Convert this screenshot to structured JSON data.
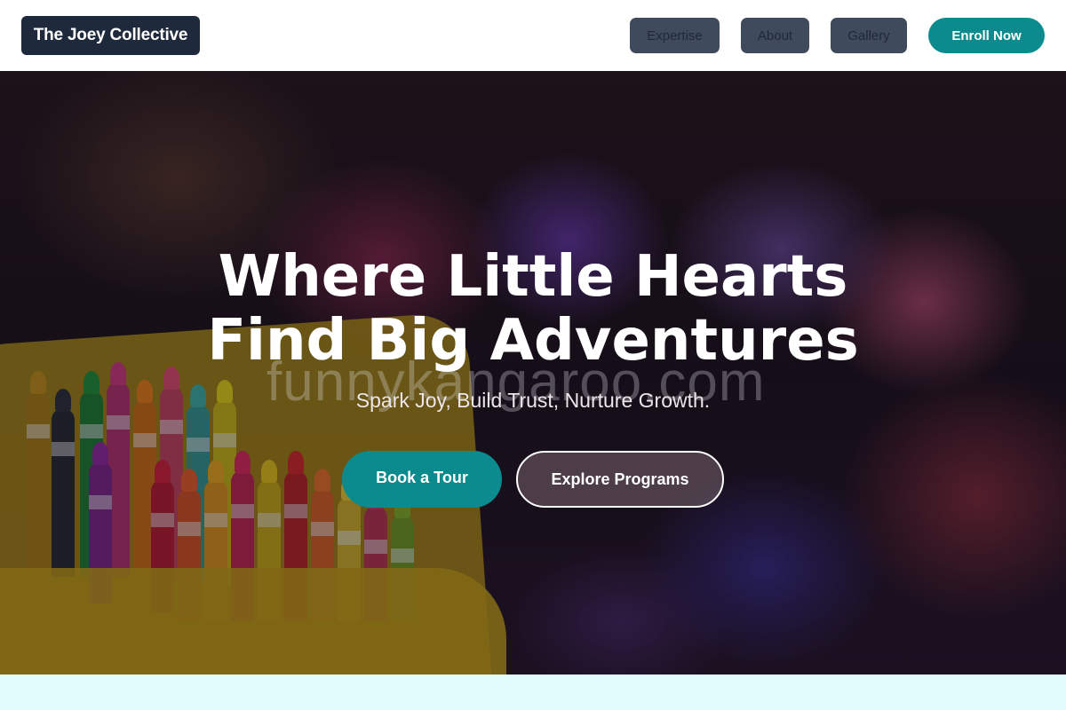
{
  "header": {
    "logo": "The Joey Collective",
    "nav": [
      {
        "label": "Expertise"
      },
      {
        "label": "About"
      },
      {
        "label": "Gallery"
      }
    ],
    "cta_label": "Enroll Now"
  },
  "hero": {
    "title_line1": "Where Little Hearts",
    "title_line2": "Find Big Adventures",
    "subtitle": "Spark Joy, Build Trust, Nurture Growth.",
    "watermark": "funnykangaroo.com",
    "primary_button": "Book a Tour",
    "secondary_button": "Explore Programs",
    "background_image": "crayons-in-yellow-box-blurred-toys"
  },
  "colors": {
    "brand_dark": "#1e293b",
    "accent_teal": "#0c8b8e",
    "nav_button": "#3f4a5c",
    "bottom_band": "#e0fcfc"
  }
}
